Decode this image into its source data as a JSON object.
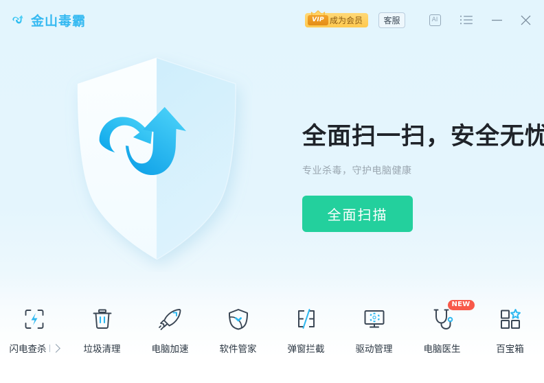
{
  "window": {
    "brand_name": "金山毒霸",
    "brand_icon": "swoosh-arrow-logo",
    "accent_blue": "#35b9f1",
    "accent_green": "#23d09d",
    "background": "#e4f5fd"
  },
  "titlebar": {
    "vip": {
      "badge_text": "VIP",
      "label": "成为会员",
      "badge_color": "#e38d16",
      "pill_color": "#ffc94e"
    },
    "support_button": "客服",
    "ai_button": "AI",
    "menu_icon": "list-menu-icon",
    "minimize_icon": "minimize-icon",
    "close_icon": "close-icon"
  },
  "hero": {
    "shield_icon": "shield-with-swoosh",
    "title": "全面扫一扫，安全无忧",
    "subtitle": "专业杀毒，守护电脑健康",
    "scan_button": "全面扫描"
  },
  "dock": {
    "items": [
      {
        "label": "闪电查杀",
        "icon": "lightning-bolt-hexagon-icon",
        "has_chevron": true,
        "badge": ""
      },
      {
        "label": "垃圾清理",
        "icon": "trash-bin-icon",
        "has_chevron": false,
        "badge": ""
      },
      {
        "label": "电脑加速",
        "icon": "rocket-icon",
        "has_chevron": false,
        "badge": ""
      },
      {
        "label": "软件管家",
        "icon": "shield-check-icon",
        "has_chevron": false,
        "badge": ""
      },
      {
        "label": "弹窗拦截",
        "icon": "popup-block-icon",
        "has_chevron": false,
        "badge": ""
      },
      {
        "label": "驱动管理",
        "icon": "monitor-gear-icon",
        "has_chevron": false,
        "badge": ""
      },
      {
        "label": "电脑医生",
        "icon": "stethoscope-icon",
        "has_chevron": false,
        "badge": "NEW"
      },
      {
        "label": "百宝箱",
        "icon": "toolbox-grid-star-icon",
        "has_chevron": false,
        "badge": ""
      }
    ],
    "badge_color": "#f8594a"
  }
}
